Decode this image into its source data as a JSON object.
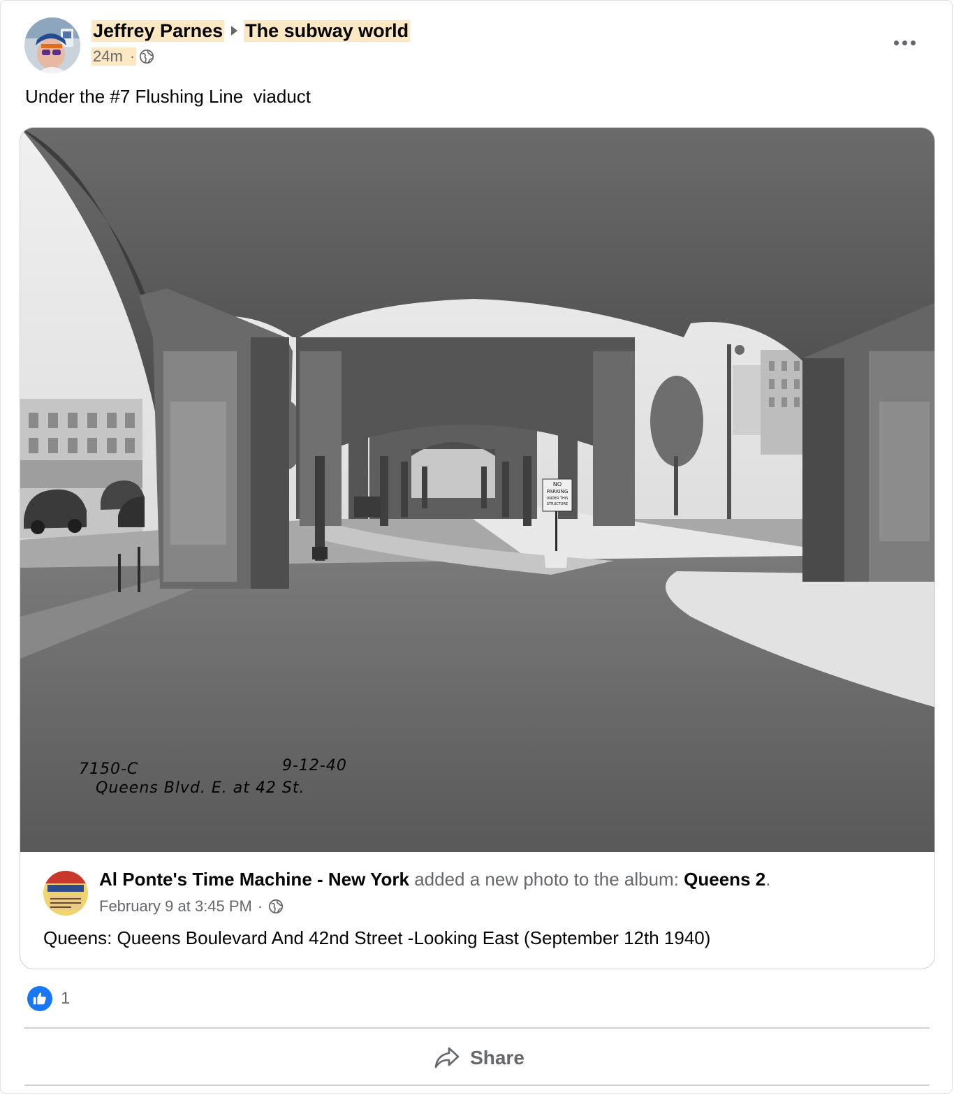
{
  "post": {
    "author": "Jeffrey Parnes",
    "group": "The subway world",
    "time": "24m",
    "meta_sep": "·",
    "text": "Under the #7 Flushing Line  viaduct",
    "more_icon": "more-horizontal-icon",
    "privacy_icon": "globe-icon"
  },
  "shared": {
    "page_name": "Al Ponte's Time Machine - New York",
    "action": " added a new photo to the album: ",
    "album": "Queens 2",
    "period": ".",
    "date": "February 9 at 3:45 PM",
    "meta_sep": "·",
    "description": "Queens: Queens Boulevard And 42nd Street -Looking East (September 12th 1940)",
    "photo": {
      "code": "7150-C",
      "date": "9-12-40",
      "location": "Queens Blvd. E. at 42 St.",
      "sign_line1": "NO",
      "sign_line2": "PARKING",
      "sign_line3": "UNDER THIS",
      "sign_line4": "STRUCTURE"
    }
  },
  "reactions": {
    "icon": "like-icon",
    "count": "1"
  },
  "actions": {
    "share_label": "Share",
    "share_icon": "share-arrow-icon"
  },
  "colors": {
    "highlight": "#fde8c4",
    "secondary_text": "#65676b",
    "like_blue": "#1877f2",
    "border": "#ced0d4"
  }
}
